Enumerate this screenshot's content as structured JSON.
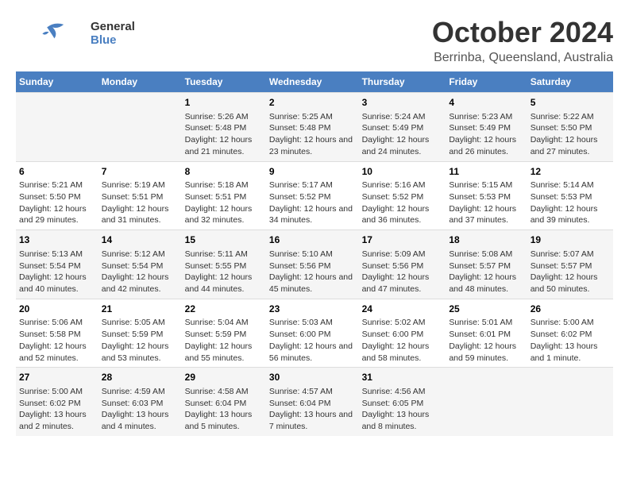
{
  "logo": {
    "line1": "General",
    "line2": "Blue"
  },
  "title": "October 2024",
  "location": "Berrinba, Queensland, Australia",
  "headers": [
    "Sunday",
    "Monday",
    "Tuesday",
    "Wednesday",
    "Thursday",
    "Friday",
    "Saturday"
  ],
  "weeks": [
    [
      {
        "day": "",
        "info": ""
      },
      {
        "day": "",
        "info": ""
      },
      {
        "day": "1",
        "sunrise": "5:26 AM",
        "sunset": "5:48 PM",
        "daylight": "12 hours and 21 minutes."
      },
      {
        "day": "2",
        "sunrise": "5:25 AM",
        "sunset": "5:48 PM",
        "daylight": "12 hours and 23 minutes."
      },
      {
        "day": "3",
        "sunrise": "5:24 AM",
        "sunset": "5:49 PM",
        "daylight": "12 hours and 24 minutes."
      },
      {
        "day": "4",
        "sunrise": "5:23 AM",
        "sunset": "5:49 PM",
        "daylight": "12 hours and 26 minutes."
      },
      {
        "day": "5",
        "sunrise": "5:22 AM",
        "sunset": "5:50 PM",
        "daylight": "12 hours and 27 minutes."
      }
    ],
    [
      {
        "day": "6",
        "sunrise": "5:21 AM",
        "sunset": "5:50 PM",
        "daylight": "12 hours and 29 minutes."
      },
      {
        "day": "7",
        "sunrise": "5:19 AM",
        "sunset": "5:51 PM",
        "daylight": "12 hours and 31 minutes."
      },
      {
        "day": "8",
        "sunrise": "5:18 AM",
        "sunset": "5:51 PM",
        "daylight": "12 hours and 32 minutes."
      },
      {
        "day": "9",
        "sunrise": "5:17 AM",
        "sunset": "5:52 PM",
        "daylight": "12 hours and 34 minutes."
      },
      {
        "day": "10",
        "sunrise": "5:16 AM",
        "sunset": "5:52 PM",
        "daylight": "12 hours and 36 minutes."
      },
      {
        "day": "11",
        "sunrise": "5:15 AM",
        "sunset": "5:53 PM",
        "daylight": "12 hours and 37 minutes."
      },
      {
        "day": "12",
        "sunrise": "5:14 AM",
        "sunset": "5:53 PM",
        "daylight": "12 hours and 39 minutes."
      }
    ],
    [
      {
        "day": "13",
        "sunrise": "5:13 AM",
        "sunset": "5:54 PM",
        "daylight": "12 hours and 40 minutes."
      },
      {
        "day": "14",
        "sunrise": "5:12 AM",
        "sunset": "5:54 PM",
        "daylight": "12 hours and 42 minutes."
      },
      {
        "day": "15",
        "sunrise": "5:11 AM",
        "sunset": "5:55 PM",
        "daylight": "12 hours and 44 minutes."
      },
      {
        "day": "16",
        "sunrise": "5:10 AM",
        "sunset": "5:56 PM",
        "daylight": "12 hours and 45 minutes."
      },
      {
        "day": "17",
        "sunrise": "5:09 AM",
        "sunset": "5:56 PM",
        "daylight": "12 hours and 47 minutes."
      },
      {
        "day": "18",
        "sunrise": "5:08 AM",
        "sunset": "5:57 PM",
        "daylight": "12 hours and 48 minutes."
      },
      {
        "day": "19",
        "sunrise": "5:07 AM",
        "sunset": "5:57 PM",
        "daylight": "12 hours and 50 minutes."
      }
    ],
    [
      {
        "day": "20",
        "sunrise": "5:06 AM",
        "sunset": "5:58 PM",
        "daylight": "12 hours and 52 minutes."
      },
      {
        "day": "21",
        "sunrise": "5:05 AM",
        "sunset": "5:59 PM",
        "daylight": "12 hours and 53 minutes."
      },
      {
        "day": "22",
        "sunrise": "5:04 AM",
        "sunset": "5:59 PM",
        "daylight": "12 hours and 55 minutes."
      },
      {
        "day": "23",
        "sunrise": "5:03 AM",
        "sunset": "6:00 PM",
        "daylight": "12 hours and 56 minutes."
      },
      {
        "day": "24",
        "sunrise": "5:02 AM",
        "sunset": "6:00 PM",
        "daylight": "12 hours and 58 minutes."
      },
      {
        "day": "25",
        "sunrise": "5:01 AM",
        "sunset": "6:01 PM",
        "daylight": "12 hours and 59 minutes."
      },
      {
        "day": "26",
        "sunrise": "5:00 AM",
        "sunset": "6:02 PM",
        "daylight": "13 hours and 1 minute."
      }
    ],
    [
      {
        "day": "27",
        "sunrise": "5:00 AM",
        "sunset": "6:02 PM",
        "daylight": "13 hours and 2 minutes."
      },
      {
        "day": "28",
        "sunrise": "4:59 AM",
        "sunset": "6:03 PM",
        "daylight": "13 hours and 4 minutes."
      },
      {
        "day": "29",
        "sunrise": "4:58 AM",
        "sunset": "6:04 PM",
        "daylight": "13 hours and 5 minutes."
      },
      {
        "day": "30",
        "sunrise": "4:57 AM",
        "sunset": "6:04 PM",
        "daylight": "13 hours and 7 minutes."
      },
      {
        "day": "31",
        "sunrise": "4:56 AM",
        "sunset": "6:05 PM",
        "daylight": "13 hours and 8 minutes."
      },
      {
        "day": "",
        "info": ""
      },
      {
        "day": "",
        "info": ""
      }
    ]
  ]
}
